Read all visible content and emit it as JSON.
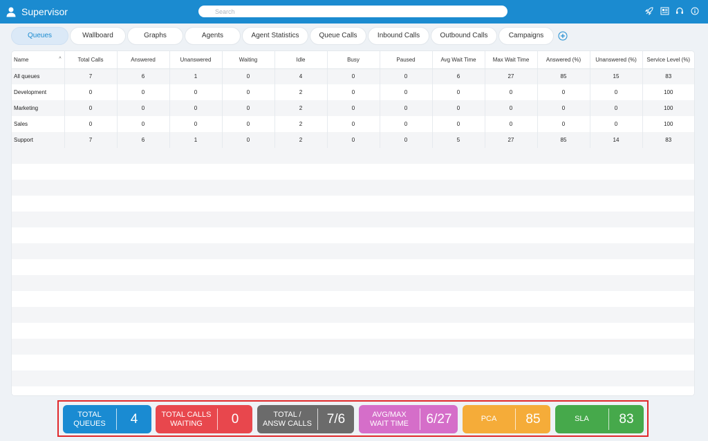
{
  "app": {
    "title": "Supervisor",
    "search_placeholder": "Search",
    "icons": [
      "user-icon",
      "rocket-icon",
      "news-icon",
      "headset-icon",
      "info-icon"
    ],
    "accent_color": "#1b8bd0"
  },
  "tabs": [
    {
      "label": "Queues",
      "active": true
    },
    {
      "label": "Wallboard"
    },
    {
      "label": "Graphs"
    },
    {
      "label": "Agents"
    },
    {
      "label": "Agent Statistics"
    },
    {
      "label": "Queue Calls"
    },
    {
      "label": "Inbound Calls"
    },
    {
      "label": "Outbound Calls"
    },
    {
      "label": "Campaigns"
    }
  ],
  "table": {
    "columns": [
      "Name",
      "Total Calls",
      "Answered",
      "Unanswered",
      "Waiting",
      "Idle",
      "Busy",
      "Paused",
      "Avg Wait Time",
      "Max Wait Time",
      "Answered (%)",
      "Unanswered (%)",
      "Service Level (%)"
    ],
    "rows": [
      [
        "All queues",
        "7",
        "6",
        "1",
        "0",
        "4",
        "0",
        "0",
        "6",
        "27",
        "85",
        "15",
        "83"
      ],
      [
        "Development",
        "0",
        "0",
        "0",
        "0",
        "2",
        "0",
        "0",
        "0",
        "0",
        "0",
        "0",
        "100"
      ],
      [
        "Marketing",
        "0",
        "0",
        "0",
        "0",
        "2",
        "0",
        "0",
        "0",
        "0",
        "0",
        "0",
        "100"
      ],
      [
        "Sales",
        "0",
        "0",
        "0",
        "0",
        "2",
        "0",
        "0",
        "0",
        "0",
        "0",
        "0",
        "100"
      ],
      [
        "Support",
        "7",
        "6",
        "1",
        "0",
        "2",
        "0",
        "0",
        "5",
        "27",
        "85",
        "14",
        "83"
      ]
    ]
  },
  "kpis": {
    "total_queues": {
      "label": "TOTAL\nQUEUES",
      "value": "4",
      "color": "#1a8bd2"
    },
    "total_calls_waiting": {
      "label": "TOTAL CALLS\nWAITING",
      "value": "0",
      "color": "#e8474d"
    },
    "total_answ_calls": {
      "label": "TOTAL /\nANSW CALLS",
      "value": "7/6",
      "color": "#6b6b6b"
    },
    "avg_max_wait": {
      "label": "AVG/MAX\nWAIT TIME",
      "value": "6/27",
      "color": "#d56ec9"
    },
    "pca": {
      "label": "PCA",
      "value": "85",
      "color": "#f5ac39"
    },
    "sla": {
      "label": "SLA",
      "value": "83",
      "color": "#46a94b"
    }
  }
}
